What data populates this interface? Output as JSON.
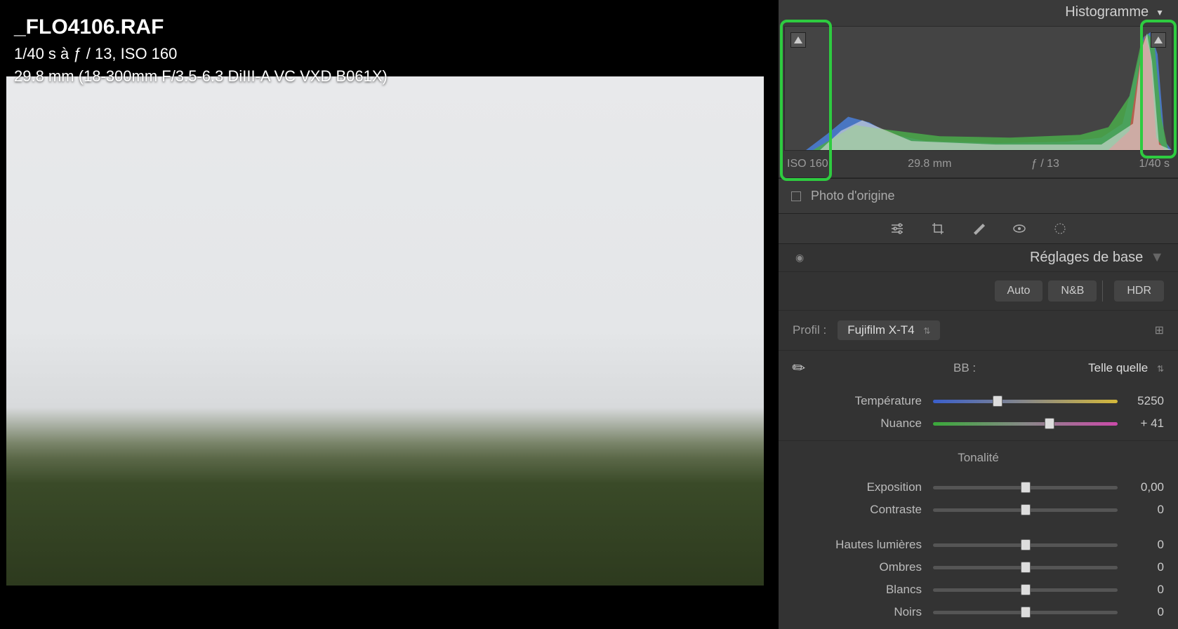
{
  "image": {
    "filename": "_FLO4106.RAF",
    "exposure_line": "1/40 s à ƒ / 13, ISO 160",
    "lens_line": "29.8 mm (18-300mm F/3.5-6.3 DiIII-A VC VXD B061X)"
  },
  "histogram": {
    "title": "Histogramme",
    "meta": {
      "iso": "ISO 160",
      "focal": "29.8 mm",
      "aperture": "ƒ / 13",
      "shutter": "1/40 s"
    }
  },
  "origin": {
    "label": "Photo d'origine"
  },
  "basic": {
    "title": "Réglages de base",
    "modes": {
      "auto": "Auto",
      "bw": "N&B",
      "hdr": "HDR"
    },
    "profile": {
      "label": "Profil :",
      "value": "Fujifilm X-T4"
    },
    "wb": {
      "label": "BB :",
      "preset": "Telle quelle"
    },
    "sliders": {
      "temperature": {
        "label": "Température",
        "value": "5250",
        "pos": 35
      },
      "tint": {
        "label": "Nuance",
        "value": "+ 41",
        "pos": 63
      }
    },
    "tonalite": {
      "title": "Tonalité",
      "exposition": {
        "label": "Exposition",
        "value": "0,00",
        "pos": 50
      },
      "contraste": {
        "label": "Contraste",
        "value": "0",
        "pos": 50
      },
      "hautes": {
        "label": "Hautes lumières",
        "value": "0",
        "pos": 50
      },
      "ombres": {
        "label": "Ombres",
        "value": "0",
        "pos": 50
      },
      "blancs": {
        "label": "Blancs",
        "value": "0",
        "pos": 50
      },
      "noirs": {
        "label": "Noirs",
        "value": "0",
        "pos": 50
      }
    }
  }
}
